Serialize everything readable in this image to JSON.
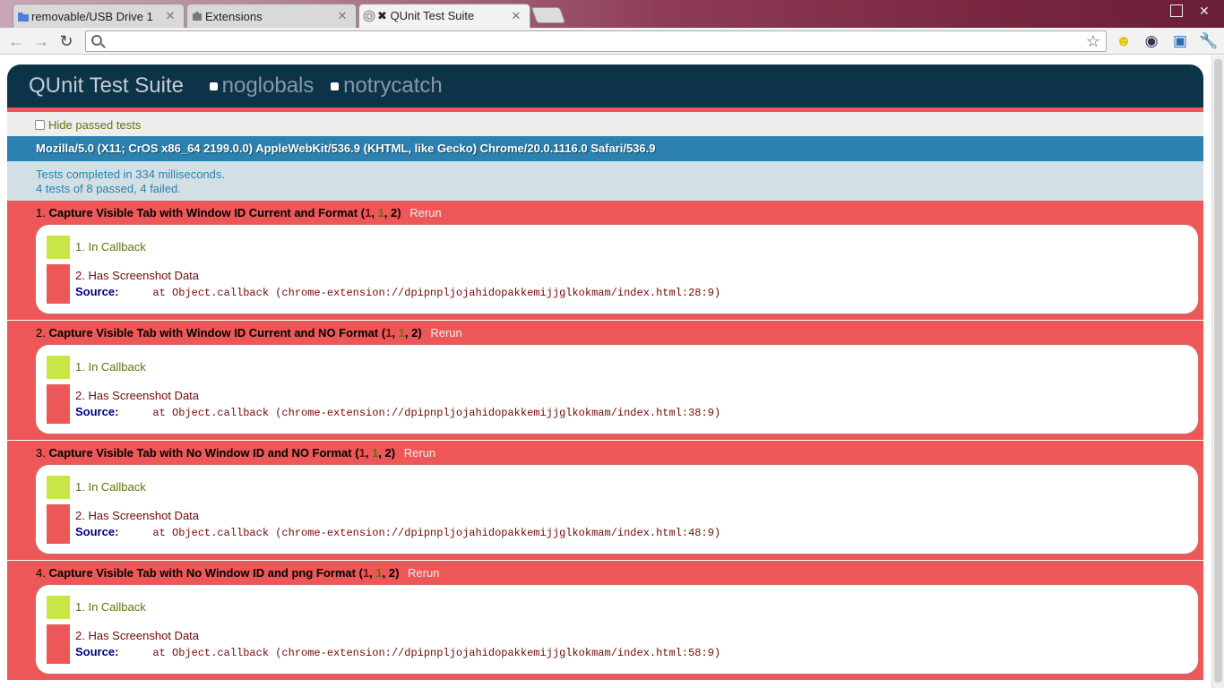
{
  "tabs": [
    {
      "title": "removable/USB Drive 1",
      "icon": "folder-icon"
    },
    {
      "title": "Extensions",
      "icon": "puzzle-icon"
    },
    {
      "title": "QUnit Test Suite",
      "icon": "globe-icon",
      "active": true
    }
  ],
  "toolbar": {
    "omnibox_value": "",
    "icons": [
      "back-arrow-icon",
      "forward-arrow-icon",
      "reload-icon",
      "star-icon",
      "smiley-extension-icon",
      "camera-extension-icon",
      "screen-capture-extension-icon",
      "wrench-icon"
    ]
  },
  "qunit": {
    "title": "QUnit Test Suite",
    "options": [
      "noglobals",
      "notrycatch"
    ],
    "hide_passed_label": "Hide passed tests",
    "user_agent": "Mozilla/5.0 (X11; CrOS x86_64 2199.0.0) AppleWebKit/536.9 (KHTML, like Gecko) Chrome/20.0.1116.0 Safari/536.9",
    "result_line1": "Tests completed in 334 milliseconds.",
    "result_line2": "4 tests of 8 passed, 4 failed.",
    "rerun_label": "Rerun",
    "source_label": "Source:",
    "tests": [
      {
        "num": "1.",
        "name": "Capture Visible Tab with Window ID Current and Format",
        "failed": "1",
        "passed": "1",
        "total": "2",
        "a1": "1. In Callback",
        "a2": "2. Has Screenshot Data",
        "source": "at Object.callback (chrome-extension://dpipnpljojahidopakkemijjglkokmam/index.html:28:9)"
      },
      {
        "num": "2.",
        "name": "Capture Visible Tab with Window ID Current and NO Format",
        "failed": "1",
        "passed": "1",
        "total": "2",
        "a1": "1. In Callback",
        "a2": "2. Has Screenshot Data",
        "source": "at Object.callback (chrome-extension://dpipnpljojahidopakkemijjglkokmam/index.html:38:9)"
      },
      {
        "num": "3.",
        "name": "Capture Visible Tab with No Window ID and NO Format",
        "failed": "1",
        "passed": "1",
        "total": "2",
        "a1": "1. In Callback",
        "a2": "2. Has Screenshot Data",
        "source": "at Object.callback (chrome-extension://dpipnpljojahidopakkemijjglkokmam/index.html:48:9)"
      },
      {
        "num": "4.",
        "name": "Capture Visible Tab with No Window ID and png Format",
        "failed": "1",
        "passed": "1",
        "total": "2",
        "a1": "1. In Callback",
        "a2": "2. Has Screenshot Data",
        "source": "at Object.callback (chrome-extension://dpipnpljojahidopakkemijjglkokmam/index.html:58:9)"
      }
    ]
  },
  "colors": {
    "fail": "#ee5757",
    "pass": "#c6e746",
    "header": "#0d3349",
    "ua": "#2b81af"
  }
}
